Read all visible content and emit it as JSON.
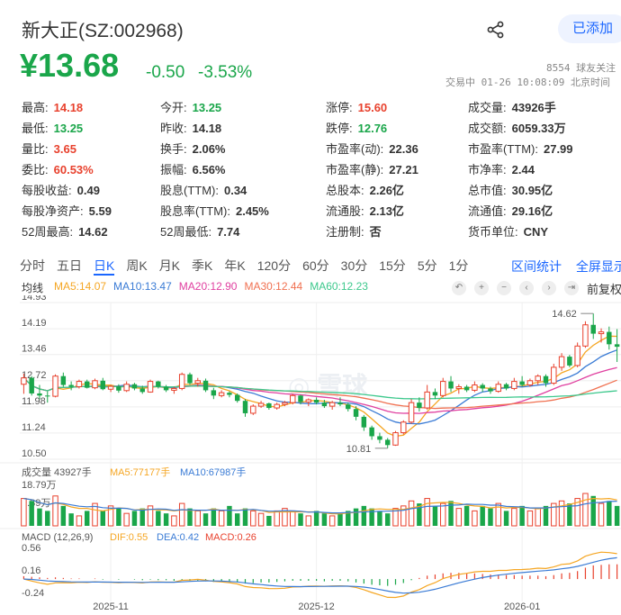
{
  "header": {
    "title": "新大正(SZ:002968)",
    "follow_label": "已添加",
    "price": "¥13.68",
    "change": "-0.50",
    "change_pct": "-3.53%",
    "followers": "8554 球友关注",
    "status": "交易中 01-26 10:08:09 北京时间"
  },
  "quote_grid": [
    [
      {
        "k": "最高:",
        "v": "14.18",
        "c": "red"
      },
      {
        "k": "今开:",
        "v": "13.25",
        "c": "green"
      },
      {
        "k": "涨停:",
        "v": "15.60",
        "c": "red"
      },
      {
        "k": "成交量:",
        "v": "43926手",
        "c": ""
      }
    ],
    [
      {
        "k": "最低:",
        "v": "13.25",
        "c": "green"
      },
      {
        "k": "昨收:",
        "v": "14.18",
        "c": ""
      },
      {
        "k": "跌停:",
        "v": "12.76",
        "c": "green"
      },
      {
        "k": "成交额:",
        "v": "6059.33万",
        "c": ""
      }
    ],
    [
      {
        "k": "量比:",
        "v": "3.65",
        "c": "red"
      },
      {
        "k": "换手:",
        "v": "2.06%",
        "c": ""
      },
      {
        "k": "市盈率(动):",
        "v": "22.36",
        "c": ""
      },
      {
        "k": "市盈率(TTM):",
        "v": "27.99",
        "c": ""
      }
    ],
    [
      {
        "k": "委比:",
        "v": "60.53%",
        "c": "red"
      },
      {
        "k": "振幅:",
        "v": "6.56%",
        "c": ""
      },
      {
        "k": "市盈率(静):",
        "v": "27.21",
        "c": ""
      },
      {
        "k": "市净率:",
        "v": "2.44",
        "c": ""
      }
    ],
    [
      {
        "k": "每股收益:",
        "v": "0.49",
        "c": ""
      },
      {
        "k": "股息(TTM):",
        "v": "0.34",
        "c": ""
      },
      {
        "k": "总股本:",
        "v": "2.26亿",
        "c": ""
      },
      {
        "k": "总市值:",
        "v": "30.95亿",
        "c": ""
      }
    ],
    [
      {
        "k": "每股净资产:",
        "v": "5.59",
        "c": ""
      },
      {
        "k": "股息率(TTM):",
        "v": "2.45%",
        "c": ""
      },
      {
        "k": "流通股:",
        "v": "2.13亿",
        "c": ""
      },
      {
        "k": "流通值:",
        "v": "29.16亿",
        "c": ""
      }
    ],
    [
      {
        "k": "52周最高:",
        "v": "14.62",
        "c": ""
      },
      {
        "k": "52周最低:",
        "v": "7.74",
        "c": ""
      },
      {
        "k": "注册制:",
        "v": "否",
        "c": ""
      },
      {
        "k": "货币单位:",
        "v": "CNY",
        "c": ""
      }
    ]
  ],
  "tabs": [
    "分时",
    "五日",
    "日K",
    "周K",
    "月K",
    "季K",
    "年K",
    "120分",
    "60分",
    "30分",
    "15分",
    "5分",
    "1分"
  ],
  "active_tab": "日K",
  "tabs_right": [
    "区间统计",
    "全屏显示"
  ],
  "ma_legend": {
    "label": "均线",
    "items": [
      {
        "t": "MA5:14.07",
        "c": "#f5a623"
      },
      {
        "t": "MA10:13.47",
        "c": "#3a7bd5"
      },
      {
        "t": "MA20:12.90",
        "c": "#e040a0"
      },
      {
        "t": "MA30:12.44",
        "c": "#f07050"
      },
      {
        "t": "MA60:12.23",
        "c": "#3cc88c"
      }
    ],
    "fq": "前复权"
  },
  "vol_legend": {
    "label": "成交量 43927手",
    "items": [
      {
        "t": "MA5:77177手",
        "c": "#f5a623"
      },
      {
        "t": "MA10:67987手",
        "c": "#3a7bd5"
      }
    ]
  },
  "macd_legend": {
    "label": "MACD (12,26,9)",
    "items": [
      {
        "t": "DIF:0.55",
        "c": "#f5a623"
      },
      {
        "t": "DEA:0.42",
        "c": "#3a7bd5"
      },
      {
        "t": "MACD:0.26",
        "c": "#e8412d"
      }
    ]
  },
  "colors": {
    "up": "#e8412d",
    "down": "#1aa64a",
    "accent": "#1a66ff"
  },
  "chart_data": {
    "type": "candlestick",
    "price_ticks": [
      "14.93",
      "14.19",
      "13.46",
      "12.72",
      "11.98",
      "11.24",
      "10.50"
    ],
    "price_range": [
      10.5,
      14.93
    ],
    "annotations": {
      "high": "14.62",
      "low": "10.81"
    },
    "volume_ticks": [
      "18.79万",
      "9.39万"
    ],
    "volume_max": 18.79,
    "macd_ticks": [
      "0.56",
      "0.16",
      "-0.24"
    ],
    "macd_range": [
      -0.3,
      0.62
    ],
    "x_labels": [
      {
        "label": "2025-11",
        "i": 11
      },
      {
        "label": "2025-12",
        "i": 37
      },
      {
        "label": "2026-01",
        "i": 63
      }
    ],
    "ohlc": [
      [
        12.62,
        12.92,
        12.35,
        12.8
      ],
      [
        12.8,
        12.85,
        12.3,
        12.36
      ],
      [
        12.36,
        12.6,
        12.2,
        12.3
      ],
      [
        12.3,
        12.42,
        12.1,
        12.28
      ],
      [
        12.28,
        12.9,
        12.25,
        12.85
      ],
      [
        12.85,
        12.95,
        12.55,
        12.6
      ],
      [
        12.6,
        12.7,
        12.45,
        12.55
      ],
      [
        12.55,
        12.75,
        12.5,
        12.7
      ],
      [
        12.7,
        12.75,
        12.5,
        12.52
      ],
      [
        12.52,
        12.78,
        12.48,
        12.72
      ],
      [
        12.72,
        12.8,
        12.45,
        12.48
      ],
      [
        12.48,
        12.6,
        12.4,
        12.56
      ],
      [
        12.56,
        12.62,
        12.38,
        12.44
      ],
      [
        12.44,
        12.7,
        12.4,
        12.62
      ],
      [
        12.62,
        12.66,
        12.45,
        12.5
      ],
      [
        12.5,
        12.58,
        12.35,
        12.4
      ],
      [
        12.4,
        12.75,
        12.38,
        12.7
      ],
      [
        12.7,
        12.72,
        12.5,
        12.55
      ],
      [
        12.55,
        12.6,
        12.4,
        12.45
      ],
      [
        12.45,
        12.55,
        12.35,
        12.5
      ],
      [
        12.5,
        12.95,
        12.45,
        12.9
      ],
      [
        12.9,
        12.95,
        12.6,
        12.65
      ],
      [
        12.65,
        12.8,
        12.55,
        12.72
      ],
      [
        12.72,
        12.78,
        12.4,
        12.45
      ],
      [
        12.45,
        12.52,
        12.2,
        12.3
      ],
      [
        12.3,
        12.45,
        12.25,
        12.38
      ],
      [
        12.38,
        12.42,
        12.25,
        12.32
      ],
      [
        12.32,
        12.36,
        12.1,
        12.15
      ],
      [
        12.15,
        12.2,
        11.7,
        11.8
      ],
      [
        11.8,
        12.05,
        11.75,
        12.0
      ],
      [
        12.0,
        12.15,
        11.95,
        12.08
      ],
      [
        12.08,
        12.1,
        11.9,
        11.95
      ],
      [
        11.95,
        12.1,
        11.9,
        12.05
      ],
      [
        12.05,
        12.15,
        12.0,
        12.1
      ],
      [
        12.1,
        12.35,
        12.05,
        12.3
      ],
      [
        12.3,
        12.32,
        12.05,
        12.12
      ],
      [
        12.12,
        12.22,
        12.0,
        12.18
      ],
      [
        12.18,
        12.25,
        12.05,
        12.1
      ],
      [
        12.1,
        12.18,
        11.95,
        12.0
      ],
      [
        12.0,
        12.15,
        11.9,
        12.1
      ],
      [
        12.1,
        12.25,
        12.0,
        12.05
      ],
      [
        12.05,
        12.1,
        11.85,
        11.92
      ],
      [
        11.92,
        12.0,
        11.6,
        11.7
      ],
      [
        11.7,
        11.75,
        11.3,
        11.4
      ],
      [
        11.4,
        11.45,
        11.05,
        11.15
      ],
      [
        11.15,
        11.25,
        10.95,
        11.05
      ],
      [
        11.05,
        11.1,
        10.81,
        10.9
      ],
      [
        10.9,
        11.3,
        10.88,
        11.25
      ],
      [
        11.25,
        11.6,
        11.2,
        11.55
      ],
      [
        11.55,
        12.2,
        11.5,
        12.1
      ],
      [
        12.1,
        12.25,
        11.85,
        11.95
      ],
      [
        11.95,
        12.6,
        11.9,
        12.4
      ],
      [
        12.4,
        12.5,
        12.2,
        12.3
      ],
      [
        12.3,
        12.8,
        12.25,
        12.7
      ],
      [
        12.7,
        12.85,
        12.4,
        12.5
      ],
      [
        12.5,
        12.62,
        12.35,
        12.55
      ],
      [
        12.55,
        12.6,
        12.4,
        12.45
      ],
      [
        12.45,
        12.7,
        12.4,
        12.6
      ],
      [
        12.6,
        12.65,
        12.4,
        12.5
      ],
      [
        12.5,
        12.55,
        12.35,
        12.42
      ],
      [
        12.42,
        12.7,
        12.38,
        12.62
      ],
      [
        12.62,
        12.66,
        12.45,
        12.5
      ],
      [
        12.5,
        12.8,
        12.45,
        12.7
      ],
      [
        12.7,
        12.85,
        12.55,
        12.6
      ],
      [
        12.6,
        12.78,
        12.55,
        12.72
      ],
      [
        12.72,
        12.9,
        12.6,
        12.85
      ],
      [
        12.85,
        12.9,
        12.55,
        12.65
      ],
      [
        12.65,
        13.2,
        12.6,
        13.1
      ],
      [
        13.1,
        13.5,
        13.0,
        13.4
      ],
      [
        13.4,
        13.45,
        13.1,
        13.15
      ],
      [
        13.15,
        13.8,
        13.1,
        13.7
      ],
      [
        13.7,
        14.4,
        13.65,
        14.3
      ],
      [
        14.3,
        14.62,
        13.9,
        14.05
      ],
      [
        14.05,
        14.2,
        13.8,
        14.1
      ],
      [
        14.1,
        14.25,
        13.6,
        13.75
      ],
      [
        13.75,
        14.18,
        13.25,
        13.68
      ]
    ],
    "volume": [
      11,
      10,
      7,
      6,
      12,
      8,
      5,
      4,
      6,
      9,
      6,
      8,
      7,
      5,
      6,
      7,
      8,
      6,
      5,
      4,
      9,
      7,
      6,
      5,
      7,
      6,
      8,
      5,
      7,
      6,
      5,
      4,
      6,
      7,
      6,
      5,
      4,
      6,
      5,
      4,
      5,
      6,
      7,
      8,
      7,
      6,
      5,
      7,
      8,
      10,
      9,
      11,
      8,
      9,
      10,
      7,
      8,
      6,
      8,
      7,
      9,
      6,
      7,
      8,
      6,
      7,
      8,
      9,
      10,
      9,
      11,
      13,
      12,
      9,
      10,
      8
    ],
    "macd_hist": [
      0.05,
      0.04,
      0.03,
      0.02,
      0.03,
      0.02,
      0.01,
      0.01,
      0.0,
      0.01,
      -0.01,
      0.0,
      -0.01,
      0.0,
      -0.01,
      -0.02,
      -0.01,
      -0.02,
      -0.02,
      -0.03,
      -0.02,
      -0.03,
      -0.03,
      -0.04,
      -0.05,
      -0.05,
      -0.05,
      -0.06,
      -0.08,
      -0.07,
      -0.06,
      -0.06,
      -0.05,
      -0.04,
      -0.03,
      -0.03,
      -0.03,
      -0.03,
      -0.04,
      -0.03,
      -0.03,
      -0.04,
      -0.06,
      -0.08,
      -0.1,
      -0.11,
      -0.12,
      -0.1,
      -0.07,
      -0.02,
      0.02,
      0.06,
      0.08,
      0.1,
      0.11,
      0.11,
      0.1,
      0.1,
      0.09,
      0.08,
      0.08,
      0.07,
      0.07,
      0.06,
      0.06,
      0.06,
      0.05,
      0.07,
      0.1,
      0.11,
      0.14,
      0.2,
      0.24,
      0.25,
      0.26,
      0.26
    ]
  }
}
